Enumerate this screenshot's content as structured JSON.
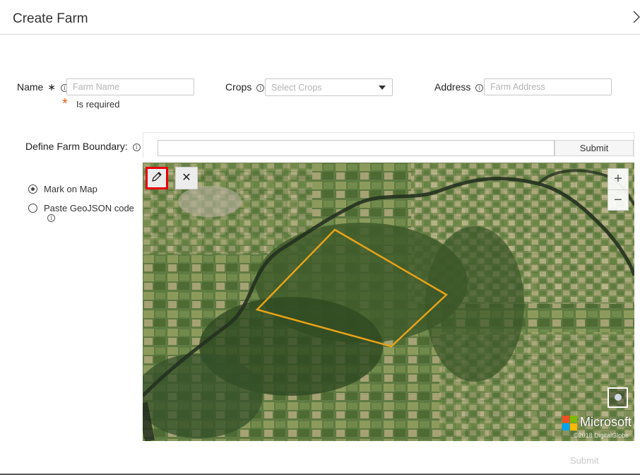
{
  "dialog": {
    "title": "Create Farm",
    "close_icon": "close-icon"
  },
  "form": {
    "name": {
      "label": "Name",
      "required_mark": "∗",
      "placeholder": "Farm Name",
      "error_star": "*",
      "error_text": "Is required"
    },
    "crops": {
      "label": "Crops",
      "placeholder": "Select Crops"
    },
    "address": {
      "label": "Address",
      "placeholder": "Farm Address"
    },
    "info_glyph": "i"
  },
  "boundary": {
    "label": "Define Farm Boundary:",
    "input_value": "",
    "submit_label": "Submit",
    "options": [
      {
        "label": "Mark on Map",
        "selected": true
      },
      {
        "label": "Paste GeoJSON code",
        "selected": false
      }
    ]
  },
  "map": {
    "draw_tool_icon": "pencil-icon",
    "clear_tool_icon": "close-icon",
    "clear_glyph": "✕",
    "zoom_in": "+",
    "zoom_out": "−",
    "brand": "Microsoft",
    "copyright": "©2018 DigitalGlobe",
    "polygon_color": "#e8a317",
    "active_tool_border": "#e8000b"
  },
  "footer": {
    "submit_label": "Submit"
  }
}
